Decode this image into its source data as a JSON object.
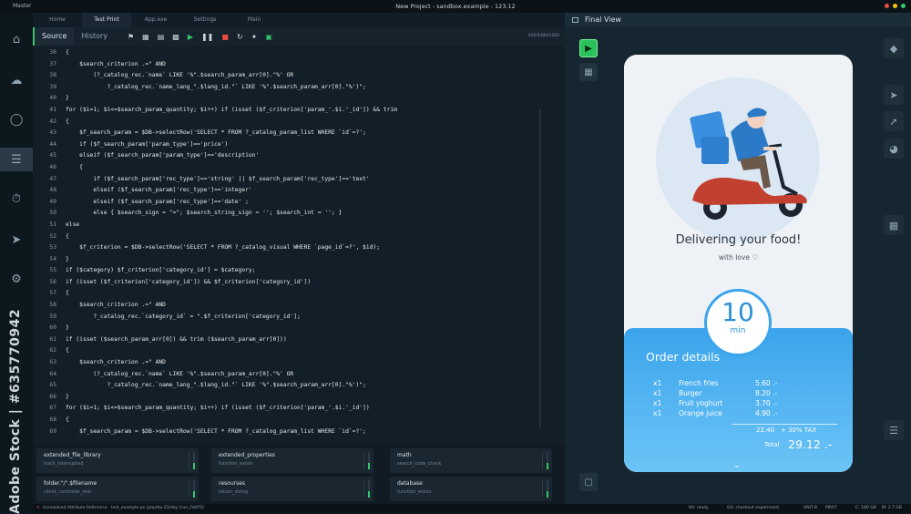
{
  "window": {
    "app_name": "Master",
    "title": "New Project - sandbox.example - 123.12"
  },
  "top_tabs": [
    "Home",
    "Test Print",
    "App.exe",
    "Settings",
    "Main"
  ],
  "editor": {
    "tabs": [
      "Source",
      "History"
    ],
    "meta": "426/6380/1283",
    "lines": [
      {
        "n": "36",
        "code": "{"
      },
      {
        "n": "37",
        "code": "    $search_criterion .=\" AND"
      },
      {
        "n": "38",
        "code": "        (?_catalog_rec.`name` LIKE '%\".$search_param_arr[0].\"%' OR"
      },
      {
        "n": "39",
        "code": "            ?_catalog_rec.`name_lang_\".$lang_id.\"` LIKE '%\".$search_param_arr[0].\"%')\";"
      },
      {
        "n": "40",
        "code": "}"
      },
      {
        "n": "41",
        "code": "for ($i=1; $i<=$search_param_quantity; $i++) if (isset ($f_criterion['param_'.$i.'_id']) && trim"
      },
      {
        "n": "42",
        "code": "{"
      },
      {
        "n": "43",
        "code": "    $f_search_param = $DB->selectRow('SELECT * FROM ?_catalog_param_list WHERE `id`=?';"
      },
      {
        "n": "44",
        "code": "    if ($f_search_param['param_type']=='price')"
      },
      {
        "n": "45",
        "code": "    elseif ($f_search_param['param_type']=='description'"
      },
      {
        "n": "46",
        "code": "    {"
      },
      {
        "n": "47",
        "code": "        if ($f_search_param['rec_type']=='string' || $f_search_param['rec_type']=='text'"
      },
      {
        "n": "48",
        "code": "        elseif ($f_search_param['rec_type']=='integer'"
      },
      {
        "n": "49",
        "code": "        elseif ($f_search_param['rec_type']=='date' ;"
      },
      {
        "n": "50",
        "code": "        else { $search_sign = \"=\"; $search_string_sign = ''; $search_int = ''; }"
      },
      {
        "n": "51",
        "code": "else"
      },
      {
        "n": "52",
        "code": "{"
      },
      {
        "n": "53",
        "code": "    $f_criterion = $DB->selectRow('SELECT * FROM ?_catalog_visual WHERE `page_id`=?', $id);"
      },
      {
        "n": "54",
        "code": "}"
      },
      {
        "n": "55",
        "code": "if ($category) $f_criterion['category_id'] = $category;"
      },
      {
        "n": "56",
        "code": "if (isset ($f_criterion['category_id']) && $f_criterion['category_id'])"
      },
      {
        "n": "57",
        "code": "{"
      },
      {
        "n": "58",
        "code": "    $search_criterion .=\" AND"
      },
      {
        "n": "59",
        "code": "        ?_catalog_rec.`category_id` = \".$f_criterion['category_id'];"
      },
      {
        "n": "60",
        "code": "}"
      },
      {
        "n": "61",
        "code": "if (isset ($search_param_arr[0]) && trim ($search_param_arr[0]))"
      },
      {
        "n": "62",
        "code": "{"
      },
      {
        "n": "63",
        "code": "    $search_criterion .=\" AND"
      },
      {
        "n": "64",
        "code": "        (?_catalog_rec.`name` LIKE '%\".$search_param_arr[0].\"%' OR"
      },
      {
        "n": "65",
        "code": "            ?_catalog_rec.`name_lang_\".$lang_id.\"` LIKE '%\".$search_param_arr[0].\"%')\";"
      },
      {
        "n": "66",
        "code": "}"
      },
      {
        "n": "67",
        "code": "for ($i=1; $i<=$search_param_quantity; $i++) if (isset ($f_criterion['param_'.$i.'_id'])"
      },
      {
        "n": "68",
        "code": "{"
      },
      {
        "n": "69",
        "code": "    $f_search_param = $DB->selectRow('SELECT * FROM ?_catalog_param_list WHERE `id`=?';"
      }
    ]
  },
  "cards": [
    {
      "title": "extended_file_library",
      "sub": "track_interrupted"
    },
    {
      "title": "extended_properties",
      "sub": "function_exists"
    },
    {
      "title": "math",
      "sub": "search_code_check"
    },
    {
      "title": "folder.\"/\".$filename",
      "sub": "client_controller_test"
    },
    {
      "title": "resourses",
      "sub": "return_string"
    },
    {
      "title": "database",
      "sub": "function_exists"
    }
  ],
  "status": {
    "left1": "Unresolved Attribute Reference",
    "left2": "test_example.px (php/hp-23/day [run_FebYS]",
    "kit": "Kit: ready",
    "git": "Git: checkout experiment",
    "enc": "UNIT-8",
    "mr": "MR07",
    "c": "C: 180 GB",
    "m": "M: 2.7 GB"
  },
  "preview": {
    "title": "Final View",
    "heading": "Delivering your food!",
    "sub": "with love ♡",
    "timer_value": "10",
    "timer_unit": "min",
    "order_title": "Order details",
    "items": [
      {
        "q": "x1",
        "name": "French fries",
        "price": "5.60 .-"
      },
      {
        "q": "x1",
        "name": "Burger",
        "price": "8.20 .-"
      },
      {
        "q": "x1",
        "name": "Fruit yoghurt",
        "price": "3.70 .-"
      },
      {
        "q": "x1",
        "name": "Orange juice",
        "price": "4.90 .-"
      }
    ],
    "subtotal": "22.40",
    "tax": "+ 30% TAX",
    "total_label": "Total",
    "total": "29.12 .-"
  },
  "watermark": "Adobe Stock | #635770942",
  "colors": {
    "accent": "#36c46a",
    "order_blue": "#3aa4ec"
  }
}
